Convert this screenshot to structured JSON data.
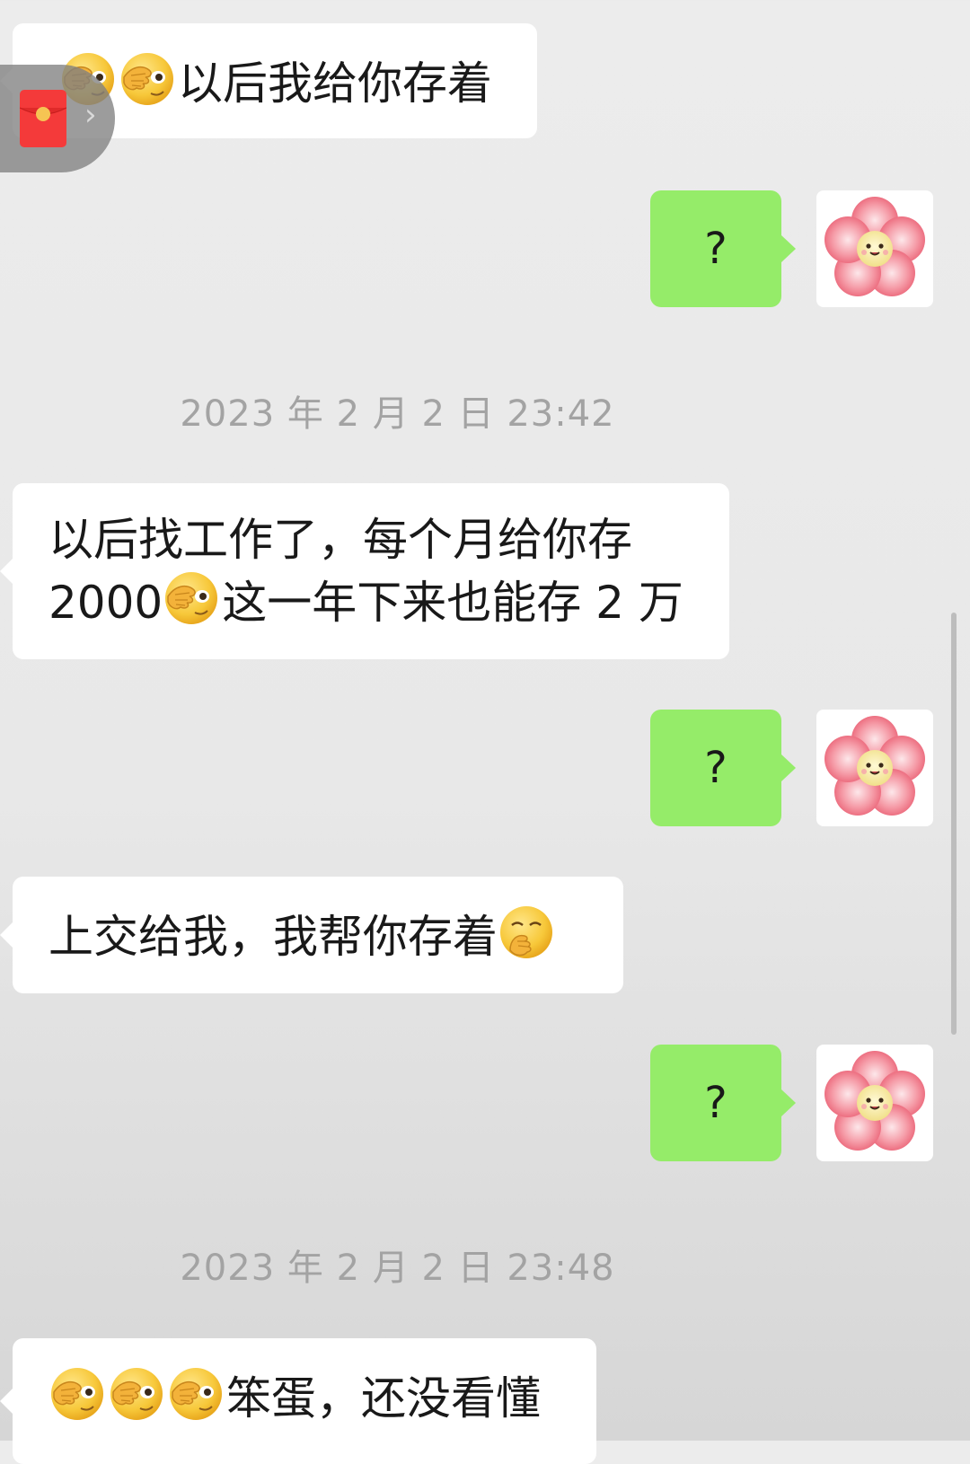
{
  "colors": {
    "background": "#ececec",
    "incoming_bubble": "#ffffff",
    "outgoing_bubble": "#95ec69",
    "timestamp_text": "#a3a3a3",
    "red_packet": "#f43a3a"
  },
  "messages": {
    "m1": {
      "text": "以后我给你存着",
      "emojis": [
        "facepalm-peek-emoji",
        "facepalm-peek-emoji"
      ]
    },
    "m2": {
      "text": "?"
    },
    "m3": {
      "line1": "以后找工作了，每个月给你存",
      "line2a": "2000",
      "line2b": "这一年下来也能存 2 万",
      "emojis": [
        "facepalm-peek-emoji"
      ]
    },
    "m4": {
      "text": "?"
    },
    "m5": {
      "text": "上交给我，我帮你存着",
      "emojis": [
        "smirk-hand-over-mouth-emoji"
      ]
    },
    "m6": {
      "text": "?"
    },
    "m7": {
      "text": "笨蛋，还没看懂",
      "emojis": [
        "facepalm-peek-emoji",
        "facepalm-peek-emoji",
        "facepalm-peek-emoji"
      ]
    }
  },
  "timestamps": {
    "t1": "2023 年 2 月 2 日  23:42",
    "t2": "2023 年 2 月 2 日  23:48"
  },
  "floating_red_packet": {
    "arrow": "›",
    "icon": "red-packet-icon"
  },
  "avatar_icon": "pink-flower-avatar"
}
